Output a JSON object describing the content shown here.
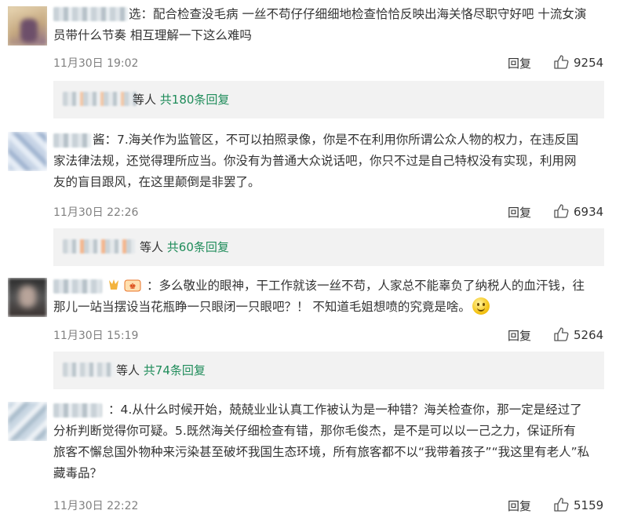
{
  "comments": [
    {
      "author_suffix": "选",
      "text_lines": [
        "：配合检查没毛病 一丝不苟仔仔细细地检查恰恰反映出海关恪尽职守好吧 十流女演",
        "员带什么节奏 相互理解一下这么难吗"
      ],
      "time": "11月30日 19:02",
      "reply_label": "回复",
      "likes": "9254",
      "sub_prefix": "等人 ",
      "sub_link": "共180条回复"
    },
    {
      "author_suffix": "酱",
      "text_lines": [
        "：7.海关作为监管区，不可以拍照录像，你是不在利用你所谓公众人物的权力，在违反国",
        "家法律法规，还觉得理所应当。你没有为普通大众说话吧，你只不过是自己特权没有实现，利用网",
        "友的盲目跟风，在这里颠倒是非罢了。"
      ],
      "time": "11月30日 22:26",
      "reply_label": "回复",
      "likes": "6934",
      "sub_prefix": "等人 ",
      "sub_link": "共60条回复"
    },
    {
      "author_suffix": "",
      "text_lines": [
        "：多么敬业的眼神，干工作就该一丝不苟，人家总不能辜负了纳税人的血汗钱，往",
        "那儿一站当摆设当花瓶睁一只眼闭一只眼吧？！ 不知道毛姐想喷的究竟是啥。"
      ],
      "time": "11月30日 15:19",
      "reply_label": "回复",
      "likes": "5264",
      "sub_prefix": "等人 ",
      "sub_link": "共74条回复"
    },
    {
      "author_suffix": "",
      "text_lines": [
        "：4.从什么时候开始，兢兢业业认真工作被认为是一种错？海关检查你，那一定是经过了",
        "分析判断觉得你可疑。5.既然海关仔细检查有错，那你毛俊杰，是不是可以以一己之力，保证所有",
        "旅客不懈怠国外物种来污染甚至破坏我国生态环境，所有旅客都不以“我带着孩子”“我这里有老人”私",
        "藏毒品？"
      ],
      "time": "11月30日 22:22",
      "reply_label": "回复",
      "likes": "5159"
    }
  ],
  "colors": {
    "link": "#1f8c5a",
    "meta": "#808080",
    "subbox_bg": "#f2f2f2"
  },
  "icons": {
    "like": "thumbs-up-icon",
    "emoji": "smiley-emoji-icon",
    "badge": "vip-badge-icon"
  }
}
